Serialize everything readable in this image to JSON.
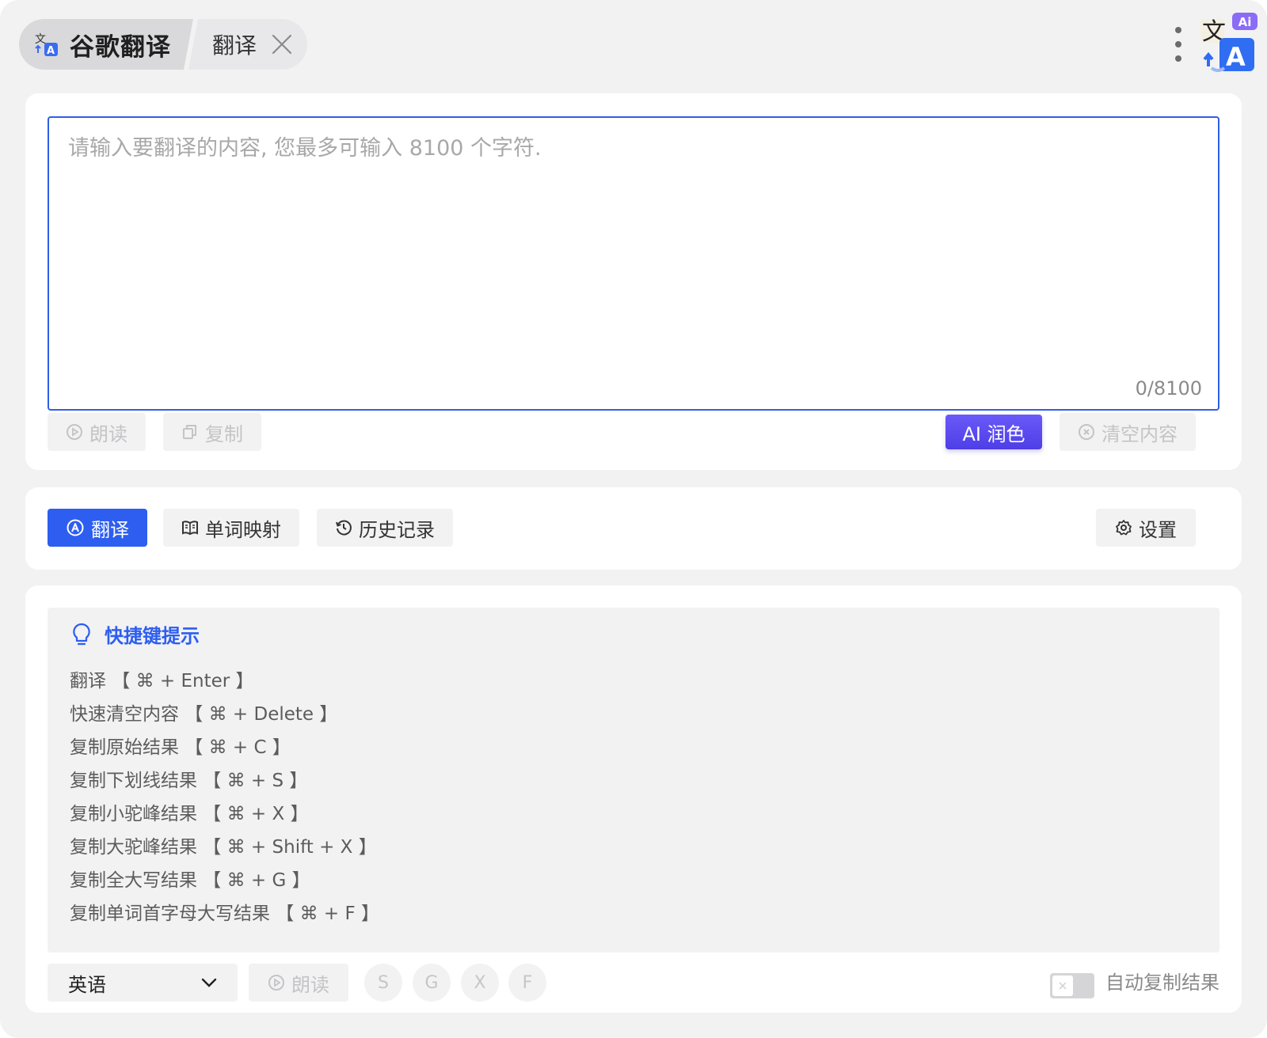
{
  "header": {
    "app_title": "谷歌翻译",
    "tab_label": "翻译",
    "logo_badge": "Ai"
  },
  "input": {
    "placeholder": "请输入要翻译的内容, 您最多可输入 8100 个字符.",
    "value": "",
    "counter": "0/8100"
  },
  "input_actions": {
    "read_label": "朗读",
    "copy_label": "复制",
    "polish_label": "AI 润色",
    "clear_label": "清空内容"
  },
  "actions": {
    "translate_label": "翻译",
    "word_map_label": "单词映射",
    "history_label": "历史记录",
    "settings_label": "设置"
  },
  "tips": {
    "title": "快捷键提示",
    "items": [
      "翻译 【 ⌘ + Enter 】",
      "快速清空内容 【 ⌘ + Delete 】",
      "复制原始结果 【 ⌘ + C 】",
      "复制下划线结果 【 ⌘ + S 】",
      "复制小驼峰结果 【 ⌘ + X 】",
      "复制大驼峰结果 【 ⌘ + Shift + X 】",
      "复制全大写结果 【 ⌘ + G 】",
      "复制单词首字母大写结果 【 ⌘ + F 】"
    ]
  },
  "footer": {
    "language": "英语",
    "read_label": "朗读",
    "format_buttons": [
      "S",
      "G",
      "X",
      "F"
    ],
    "auto_copy_label": "自动复制结果",
    "auto_copy_enabled": false
  },
  "colors": {
    "accent": "#2d5ef0",
    "ai_purple": "#5b4bf0",
    "disabled_text": "#c4c4c6"
  },
  "icons": {
    "app": "translate-icon",
    "close": "close-icon",
    "menu": "kebab-menu-icon",
    "read": "play-circle-icon",
    "copy": "copy-icon",
    "clear": "close-circle-icon",
    "translate": "translate-circle-icon",
    "word_map": "book-icon",
    "history": "history-icon",
    "settings": "gear-icon",
    "tips": "lightbulb-icon",
    "select": "chevron-down-icon"
  }
}
